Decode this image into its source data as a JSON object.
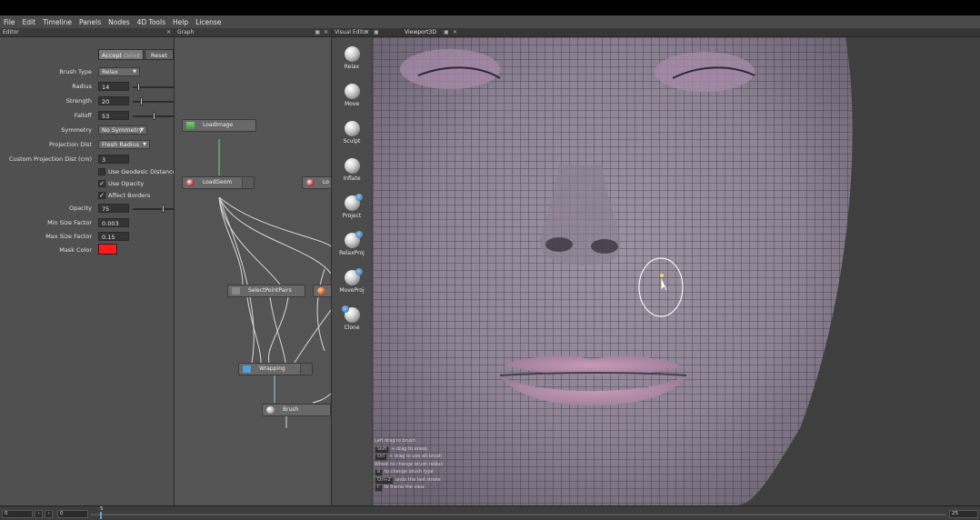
{
  "menu": [
    "File",
    "Edit",
    "Timeline",
    "Panels",
    "Nodes",
    "4D Tools",
    "Help",
    "License"
  ],
  "panels": {
    "editor_title": "Editor",
    "graph_title": "Graph",
    "visual_editor_title": "Visual Editor",
    "viewport_title": "Viewport3D"
  },
  "editor": {
    "accept_label": "Accept",
    "accept_shortcut": "Ctrl+E",
    "reset_label": "Reset",
    "brush_type": {
      "label": "Brush Type",
      "value": "Relax"
    },
    "radius": {
      "label": "Radius",
      "value": "14",
      "fraction": 0.12
    },
    "strength": {
      "label": "Strength",
      "value": "20",
      "fraction": 0.2
    },
    "falloff": {
      "label": "Falloff",
      "value": "53",
      "fraction": 0.53
    },
    "symmetry": {
      "label": "Symmetry",
      "value": "No Symmetry"
    },
    "projection_dist": {
      "label": "Projection Dist",
      "value": "Fresh Radius"
    },
    "custom_projection_dist": {
      "label": "Custom Projection Dist (cm)",
      "value": "3"
    },
    "use_geodesic": {
      "label": "Use Geodesic Distance",
      "checked": false
    },
    "use_opacity": {
      "label": "Use Opacity",
      "checked": true
    },
    "affect_borders": {
      "label": "Affect Borders",
      "checked": true
    },
    "opacity": {
      "label": "Opacity",
      "value": "75",
      "fraction": 0.75
    },
    "min_size_factor": {
      "label": "Min Size Factor",
      "value": "0.003"
    },
    "max_size_factor": {
      "label": "Max Size Factor",
      "value": "0.15"
    },
    "mask_color": {
      "label": "Mask Color",
      "value": "#ff1a1a"
    }
  },
  "graph": {
    "nodes": [
      "LoadImage",
      "LoadGeom",
      "Lo",
      "SelectPointPairs",
      "Wrapping",
      "Brush"
    ]
  },
  "tools": [
    "Relax",
    "Move",
    "Sculpt",
    "Inflate",
    "Project",
    "RelaxProj",
    "MoveProj",
    "Clone"
  ],
  "hints": [
    {
      "key": "",
      "text": "Left drag to brush"
    },
    {
      "key": "Shift",
      "text": "+ drag to erase"
    },
    {
      "key": "Ctrl",
      "text": "+ drag to use alt brush"
    },
    {
      "key": "",
      "text": "Wheel to change brush radius"
    },
    {
      "key": "B",
      "text": "to change brush type"
    },
    {
      "key": "Ctrl+Z",
      "text": "undo the last stroke"
    },
    {
      "key": "F",
      "text": "to frame the view"
    }
  ],
  "timeline": {
    "start": "0",
    "current": "0",
    "marker": "5",
    "end": "25"
  }
}
